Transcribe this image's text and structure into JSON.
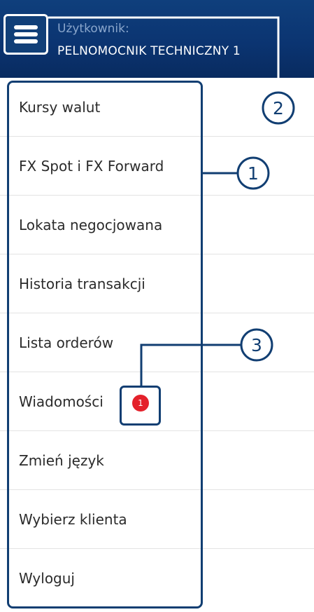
{
  "header": {
    "user_label": "Użytkownik:",
    "user_name": "PELNOMOCNIK TECHNICZNY 1",
    "menu_icon": "hamburger-menu-icon"
  },
  "menu": {
    "items": [
      {
        "label": "Kursy walut"
      },
      {
        "label": "FX Spot i FX Forward"
      },
      {
        "label": "Lokata negocjowana"
      },
      {
        "label": "Historia transakcji"
      },
      {
        "label": "Lista orderów"
      },
      {
        "label": "Wiadomości",
        "badge": "1"
      },
      {
        "label": "Zmień język"
      },
      {
        "label": "Wybierz klienta"
      },
      {
        "label": "Wyloguj"
      }
    ]
  },
  "callouts": {
    "one": "1",
    "two": "2",
    "three": "3"
  },
  "colors": {
    "header_bg": "#0b3471",
    "callout_stroke": "#113e72",
    "badge": "#e4212b",
    "text": "#2b2b2b",
    "divider": "#e3e3e3"
  }
}
